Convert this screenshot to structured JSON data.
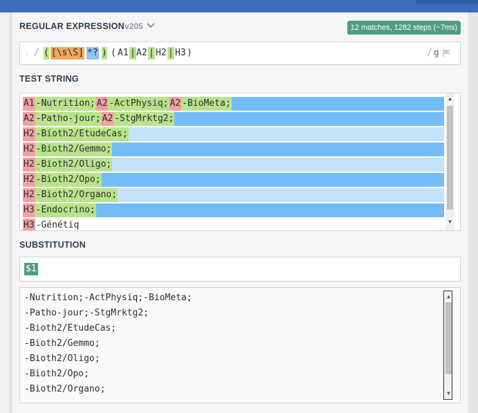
{
  "regex_section": {
    "title": "REGULAR EXPRESSION",
    "version": "v205",
    "match_info": "12 matches, 1282 steps (~7ms)",
    "delimiter_open": "/",
    "delimiter_close": "/",
    "flags": "g",
    "tokens": [
      "(",
      "[\\s\\S]",
      "*?",
      ")",
      "(",
      "A1",
      "|",
      "A2",
      "|",
      "H2",
      "|",
      "H3",
      ")"
    ]
  },
  "test_section": {
    "title": "TEST STRING",
    "lines": [
      [
        [
          "A1",
          "red"
        ],
        [
          "-Nutrition;",
          "green"
        ],
        [
          "A2",
          "red"
        ],
        [
          "-ActPhysiq;",
          "green"
        ],
        [
          "A2",
          "red"
        ],
        [
          "-BioMeta;",
          "green"
        ]
      ],
      [
        [
          "A2",
          "red"
        ],
        [
          "-Patho-jour;",
          "green"
        ],
        [
          "A2",
          "red"
        ],
        [
          "-StgMrktg2;",
          "green"
        ]
      ],
      [
        [
          "H2",
          "red"
        ],
        [
          "-Bioth2/EtudeCas;",
          "green"
        ]
      ],
      [
        [
          "H2",
          "red"
        ],
        [
          "-Bioth2/Gemmo;",
          "green"
        ]
      ],
      [
        [
          "H2",
          "red"
        ],
        [
          "-Bioth2/Oligo;",
          "green"
        ]
      ],
      [
        [
          "H2",
          "red"
        ],
        [
          "-Bioth2/Opo;",
          "green"
        ]
      ],
      [
        [
          "H2",
          "red"
        ],
        [
          "-Bioth2/Organo;",
          "green"
        ]
      ],
      [
        [
          "H3",
          "red"
        ],
        [
          "-Endocrino;",
          "green"
        ]
      ],
      [
        [
          "H3",
          "red"
        ],
        [
          "-Génétiq",
          "plain"
        ]
      ]
    ],
    "row_fill_colors": [
      "#72bdf7",
      "#72bdf7",
      "#c4e2fb",
      "#72bdf7",
      "#c4e2fb",
      "#72bdf7",
      "#c4e2fb",
      "#72bdf7",
      "#ffffff"
    ]
  },
  "substitution_section": {
    "title": "SUBSTITUTION",
    "value": "$1",
    "results": [
      "-Nutrition;-ActPhysiq;-BioMeta;",
      "-Patho-jour;-StgMrktg2;",
      "-Bioth2/EtudeCas;",
      "-Bioth2/Gemmo;",
      "-Bioth2/Oligo;",
      "-Bioth2/Opo;",
      "-Bioth2/Organo;"
    ]
  },
  "colors": {
    "accent": "#4f9c85",
    "match_red": "#f4a0a0",
    "match_green": "#b9e38a",
    "match_blue": "#72bdf7",
    "match_lightblue": "#c4e2fb",
    "header": "#3d6fb8"
  },
  "icons": {
    "version_toggle": "chevron-down-icon",
    "flags": "flag-icon"
  }
}
